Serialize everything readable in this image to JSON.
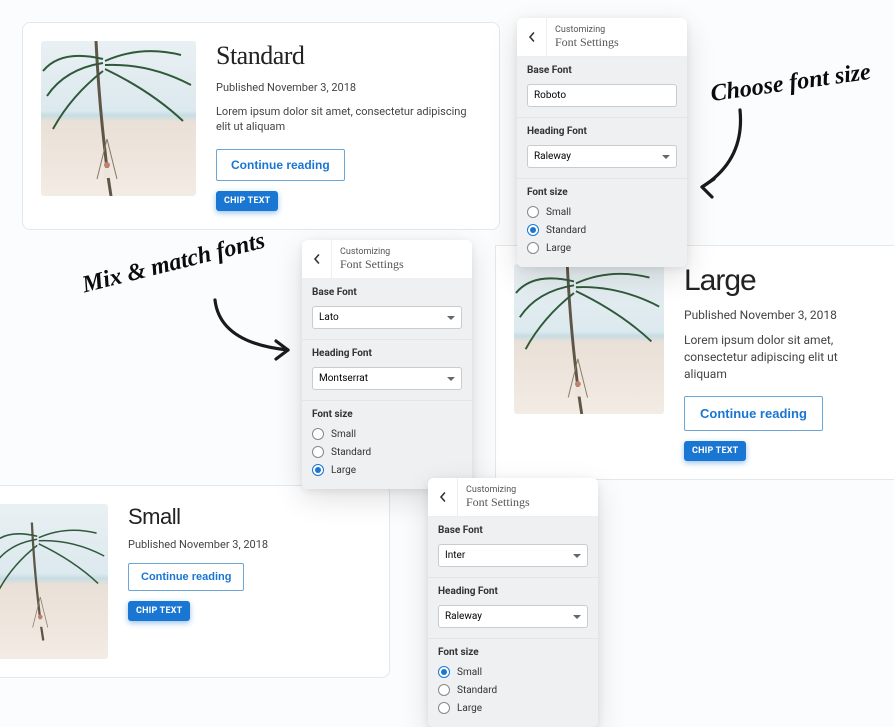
{
  "annotations": {
    "choose_font_size": "Choose font size",
    "mix_match_fonts": "Mix & match fonts"
  },
  "article": {
    "published": "Published November 3, 2018",
    "excerpt_long": "Lorem ipsum dolor sit amet, consectetur adipiscing elit ut aliquam",
    "continue_label": "Continue reading",
    "chip_label": "CHIP TEXT"
  },
  "cards": {
    "standard": {
      "title": "Standard"
    },
    "large": {
      "title": "Large"
    },
    "small": {
      "title": "Small"
    }
  },
  "customizer": {
    "sup": "Customizing",
    "sub": "Font Settings",
    "base_label": "Base Font",
    "heading_label": "Heading Font",
    "size_label": "Font size",
    "sizes": {
      "small": "Small",
      "standard": "Standard",
      "large": "Large"
    }
  },
  "panel1": {
    "base": "Roboto",
    "heading": "Raleway",
    "selected": "standard"
  },
  "panel2": {
    "base": "Lato",
    "heading": "Montserrat",
    "selected": "large"
  },
  "panel3": {
    "base": "Inter",
    "heading": "Raleway",
    "selected": "small"
  },
  "colors": {
    "accent": "#1976d2"
  }
}
